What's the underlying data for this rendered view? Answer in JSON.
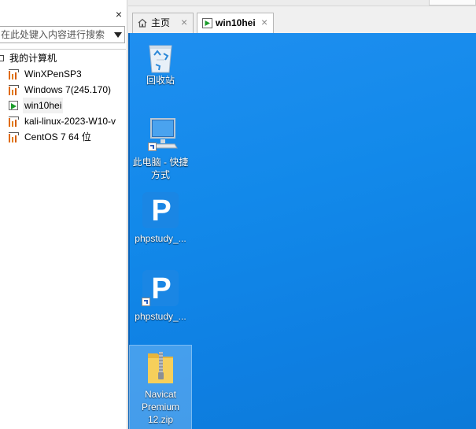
{
  "library": {
    "close_glyph": "×",
    "search_placeholder": "在此处键入内容进行搜索",
    "root_label": "我的计算机",
    "vms": [
      {
        "label": "WinXPenSP3",
        "state": "off"
      },
      {
        "label": "Windows 7(245.170)",
        "state": "off"
      },
      {
        "label": "win10hei",
        "state": "running"
      },
      {
        "label": "kali-linux-2023-W10-v",
        "state": "off"
      },
      {
        "label": "CentOS 7 64 位",
        "state": "off"
      }
    ]
  },
  "tabs": {
    "home_label": "主页",
    "vm_label": "win10hei",
    "close_glyph": "×"
  },
  "desktop": {
    "icons": [
      {
        "label": "回收站",
        "icon": "recycle-bin-icon"
      },
      {
        "label": "此电脑 - 快捷\n方式",
        "icon": "computer-icon"
      },
      {
        "label": "phpstudy_...",
        "icon": "phpstudy-icon"
      },
      {
        "label": "phpstudy_...",
        "icon": "phpstudy-icon"
      },
      {
        "label": "Navicat\nPremium\n12.zip",
        "icon": "zip-folder-icon"
      }
    ],
    "phpstudy_letter": "P"
  },
  "colors": {
    "desktop_bg": "#1289ea",
    "running_accent": "#1a9c2a",
    "vm_icon_accent": "#e06a00"
  }
}
